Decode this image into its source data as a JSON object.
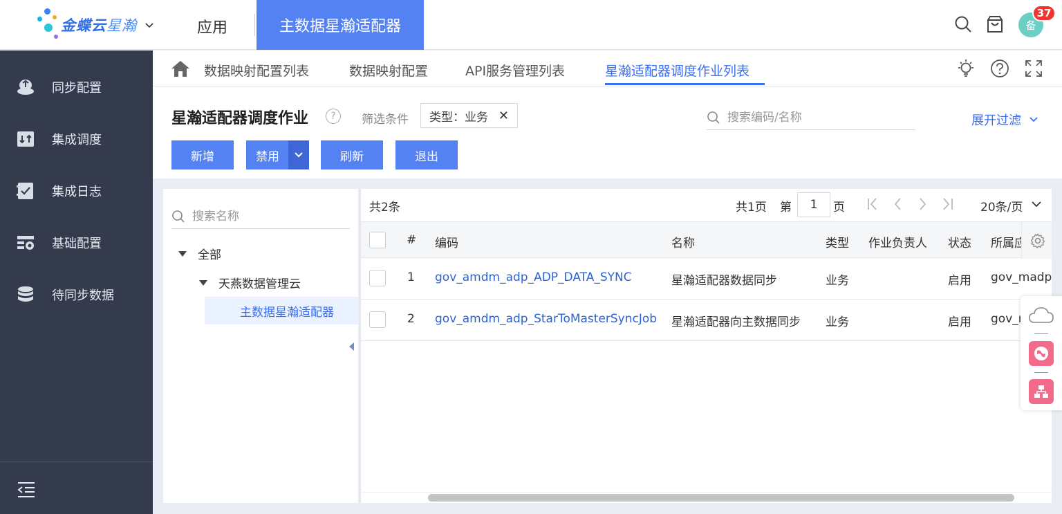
{
  "brand": {
    "name": "金蝶云",
    "suffix": "星瀚"
  },
  "top": {
    "app_menu": "应用",
    "app_tab": "主数据星瀚适配器",
    "avatar": "备",
    "notification_count": "37"
  },
  "sidebar": {
    "items": [
      {
        "label": "同步配置",
        "icon": "sync-config-icon"
      },
      {
        "label": "集成调度",
        "icon": "schedule-icon"
      },
      {
        "label": "集成日志",
        "icon": "log-icon"
      },
      {
        "label": "基础配置",
        "icon": "base-config-icon"
      },
      {
        "label": "待同步数据",
        "icon": "database-icon"
      }
    ]
  },
  "tabs": [
    {
      "label": "数据映射配置列表"
    },
    {
      "label": "数据映射配置"
    },
    {
      "label": "API服务管理列表"
    },
    {
      "label": "星瀚适配器调度作业列表"
    }
  ],
  "header": {
    "title": "星瀚适配器调度作业",
    "filter_label": "筛选条件",
    "filter_chip": "类型：业务",
    "search_placeholder": "搜索编码/名称",
    "expand_filter": "展开过滤"
  },
  "toolbar": {
    "add": "新增",
    "disable": "禁用",
    "refresh": "刷新",
    "exit": "退出"
  },
  "tree": {
    "search_placeholder": "搜索名称",
    "root": "全部",
    "child": "天燕数据管理云",
    "selected": "主数据星瀚适配器"
  },
  "grid": {
    "total": "共2条",
    "pages_total": "共1页",
    "page_prefix": "第",
    "page_value": "1",
    "page_suffix": "页",
    "page_size": "20条/页",
    "columns": {
      "index": "#",
      "code": "编码",
      "name": "名称",
      "type": "类型",
      "owner": "作业负责人",
      "status": "状态",
      "belong": "所属应"
    },
    "rows": [
      {
        "index": "1",
        "code": "gov_amdm_adp_ADP_DATA_SYNC",
        "name": "星瀚适配器数据同步",
        "type": "业务",
        "owner": "",
        "status": "启用",
        "belong": "gov_madp"
      },
      {
        "index": "2",
        "code": "gov_amdm_adp_StarToMasterSyncJob",
        "name": "星瀚适配器向主数据同步",
        "type": "业务",
        "owner": "",
        "status": "启用",
        "belong": "gov_m"
      }
    ]
  },
  "colors": {
    "accent": "#5582f3",
    "link": "#2c63d6",
    "sidebar_bg": "#343b4d",
    "badge": "#f0342f"
  }
}
